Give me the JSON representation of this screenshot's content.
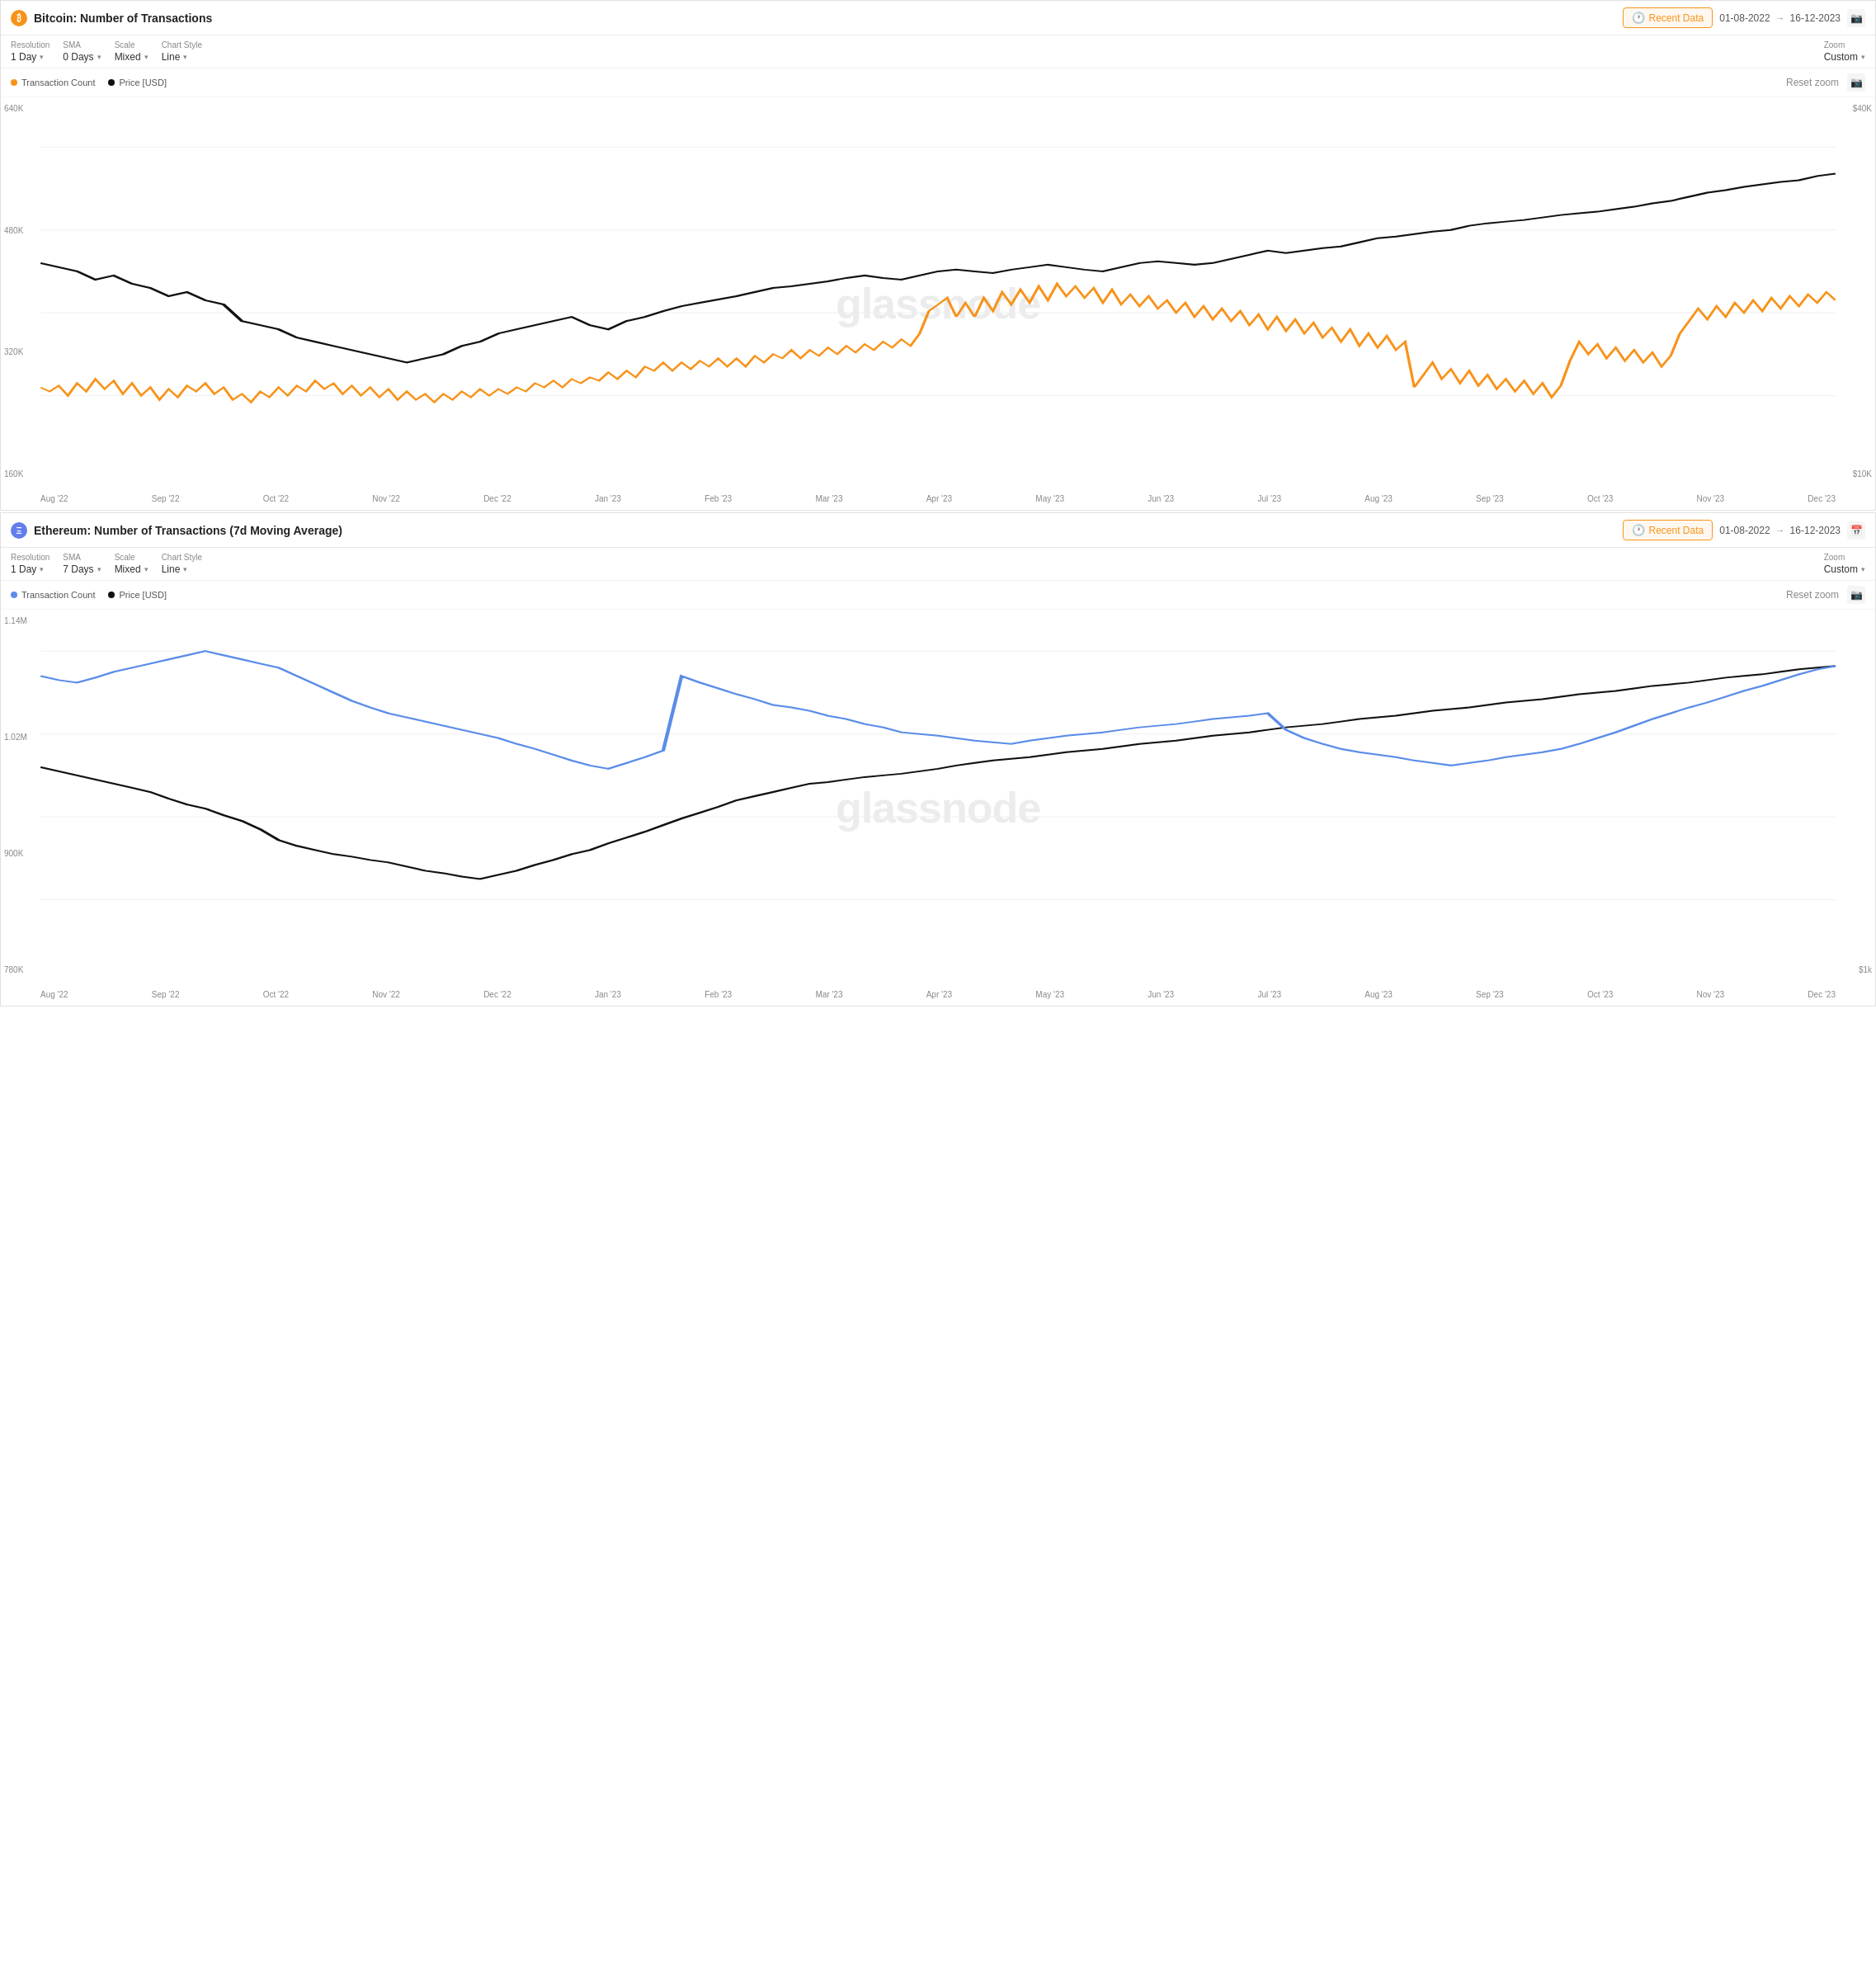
{
  "charts": [
    {
      "id": "btc-chart",
      "coin_icon_class": "btc-icon",
      "coin_symbol": "₿",
      "title": "Bitcoin: Number of Transactions",
      "recent_data_label": "Recent Data",
      "date_from": "01-08-2022",
      "date_to": "16-12-2023",
      "controls": {
        "resolution_label": "Resolution",
        "resolution_value": "1 Day",
        "sma_label": "SMA",
        "sma_value": "0 Days",
        "scale_label": "Scale",
        "scale_value": "Mixed",
        "chart_style_label": "Chart Style",
        "chart_style_value": "Line",
        "zoom_label": "Zoom",
        "zoom_value": "Custom"
      },
      "legend": {
        "series1_color": "#f7931a",
        "series1_label": "Transaction Count",
        "series2_color": "#111",
        "series2_label": "Price [USD]"
      },
      "reset_zoom_label": "Reset zoom",
      "y_axis_left": [
        "640K",
        "480K",
        "320K",
        "160K"
      ],
      "y_axis_right": [
        "$40K",
        "$10K"
      ],
      "x_axis": [
        "Aug '22",
        "Sep '22",
        "Oct '22",
        "Nov '22",
        "Dec '22",
        "Jan '23",
        "Feb '23",
        "Mar '23",
        "Apr '23",
        "May '23",
        "Jun '23",
        "Jul '23",
        "Aug '23",
        "Sep '23",
        "Oct '23",
        "Nov '23",
        "Dec '23"
      ],
      "watermark": "glassnode",
      "color": "#f7931a",
      "line_color": "#111"
    },
    {
      "id": "eth-chart",
      "coin_icon_class": "eth-icon",
      "coin_symbol": "Ξ",
      "title": "Ethereum: Number of Transactions (7d Moving Average)",
      "recent_data_label": "Recent Data",
      "date_from": "01-08-2022",
      "date_to": "16-12-2023",
      "controls": {
        "resolution_label": "Resolution",
        "resolution_value": "1 Day",
        "sma_label": "SMA",
        "sma_value": "7 Days",
        "scale_label": "Scale",
        "scale_value": "Mixed",
        "chart_style_label": "Chart Style",
        "chart_style_value": "Line",
        "zoom_label": "Zoom",
        "zoom_value": "Custom"
      },
      "legend": {
        "series1_color": "#5b8de8",
        "series1_label": "Transaction Count",
        "series2_color": "#111",
        "series2_label": "Price [USD]"
      },
      "reset_zoom_label": "Reset zoom",
      "y_axis_left": [
        "1.14M",
        "1.02M",
        "900K",
        "780K"
      ],
      "y_axis_right": [
        "$1k"
      ],
      "x_axis": [
        "Aug '22",
        "Sep '22",
        "Oct '22",
        "Nov '22",
        "Dec '22",
        "Jan '23",
        "Feb '23",
        "Mar '23",
        "Apr '23",
        "May '23",
        "Jun '23",
        "Jul '23",
        "Aug '23",
        "Sep '23",
        "Oct '23",
        "Nov '23",
        "Dec '23"
      ],
      "watermark": "glassnode",
      "color": "#5b8de8",
      "line_color": "#111"
    }
  ]
}
